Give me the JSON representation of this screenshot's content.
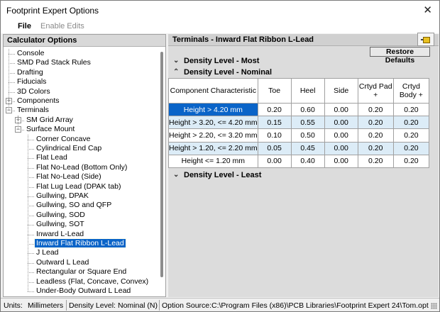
{
  "window": {
    "title": "Footprint Expert Options"
  },
  "menu": {
    "file": "File",
    "enable_edits": "Enable Edits"
  },
  "left_panel": {
    "header": "Calculator Options",
    "tree": [
      {
        "label": "Console",
        "level": 0
      },
      {
        "label": "SMD Pad Stack Rules",
        "level": 0
      },
      {
        "label": "Drafting",
        "level": 0
      },
      {
        "label": "Fiducials",
        "level": 0
      },
      {
        "label": "3D Colors",
        "level": 0
      },
      {
        "label": "Components",
        "level": 0,
        "toggle": "+"
      },
      {
        "label": "Terminals",
        "level": 0,
        "toggle": "-"
      },
      {
        "label": "SM Grid Array",
        "level": 1,
        "toggle": "+"
      },
      {
        "label": "Surface Mount",
        "level": 1,
        "toggle": "-"
      },
      {
        "label": "Corner Concave",
        "level": 2
      },
      {
        "label": "Cylindrical End Cap",
        "level": 2
      },
      {
        "label": "Flat Lead",
        "level": 2
      },
      {
        "label": "Flat No-Lead (Bottom Only)",
        "level": 2
      },
      {
        "label": "Flat No-Lead (Side)",
        "level": 2
      },
      {
        "label": "Flat Lug Lead (DPAK tab)",
        "level": 2
      },
      {
        "label": "Gullwing, DPAK",
        "level": 2
      },
      {
        "label": "Gullwing, SO and QFP",
        "level": 2
      },
      {
        "label": "Gullwing, SOD",
        "level": 2
      },
      {
        "label": "Gullwing, SOT",
        "level": 2
      },
      {
        "label": "Inward L-Lead",
        "level": 2
      },
      {
        "label": "Inward Flat Ribbon L-Lead",
        "level": 2,
        "selected": true
      },
      {
        "label": "J Lead",
        "level": 2
      },
      {
        "label": "Outward L Lead",
        "level": 2
      },
      {
        "label": "Rectangular or Square End",
        "level": 2
      },
      {
        "label": "Leadless (Flat, Concave, Convex)",
        "level": 2
      },
      {
        "label": "Under-Body Outward L Lead",
        "level": 2
      }
    ]
  },
  "right_panel": {
    "header": "Terminals - Inward Flat Ribbon L-Lead",
    "logo_icon": "footprint-chip-icon",
    "restore_label": "Restore Defaults",
    "sections": {
      "most": "Density Level - Most",
      "nominal": "Density Level - Nominal",
      "least": "Density Level - Least"
    },
    "table": {
      "columns": [
        "Component Characteristic",
        "Toe",
        "Heel",
        "Side",
        "Crtyd Pad +",
        "Crtyd Body +"
      ],
      "rows": [
        {
          "label": "Height > 4.20 mm",
          "values": [
            "0.20",
            "0.60",
            "0.00",
            "0.20",
            "0.20"
          ],
          "selected": true
        },
        {
          "label": "Height > 3.20, <= 4.20 mm",
          "values": [
            "0.15",
            "0.55",
            "0.00",
            "0.20",
            "0.20"
          ]
        },
        {
          "label": "Height > 2.20, <= 3.20 mm",
          "values": [
            "0.10",
            "0.50",
            "0.00",
            "0.20",
            "0.20"
          ]
        },
        {
          "label": "Height > 1.20, <= 2.20 mm",
          "values": [
            "0.05",
            "0.45",
            "0.00",
            "0.20",
            "0.20"
          ]
        },
        {
          "label": "Height <= 1.20 mm",
          "values": [
            "0.00",
            "0.40",
            "0.00",
            "0.20",
            "0.20"
          ]
        }
      ]
    }
  },
  "status": {
    "units_label": "Units:",
    "units_value": "Millimeters",
    "density_label": "Density Level:",
    "density_value": "Nominal (N)",
    "source_label": "Option Source:",
    "source_value": "C:\\Program Files (x86)\\PCB Libraries\\Footprint Expert 24\\Tom.opt"
  },
  "colors": {
    "selection": "#0a64c8",
    "alt_row": "#dcecf7"
  }
}
